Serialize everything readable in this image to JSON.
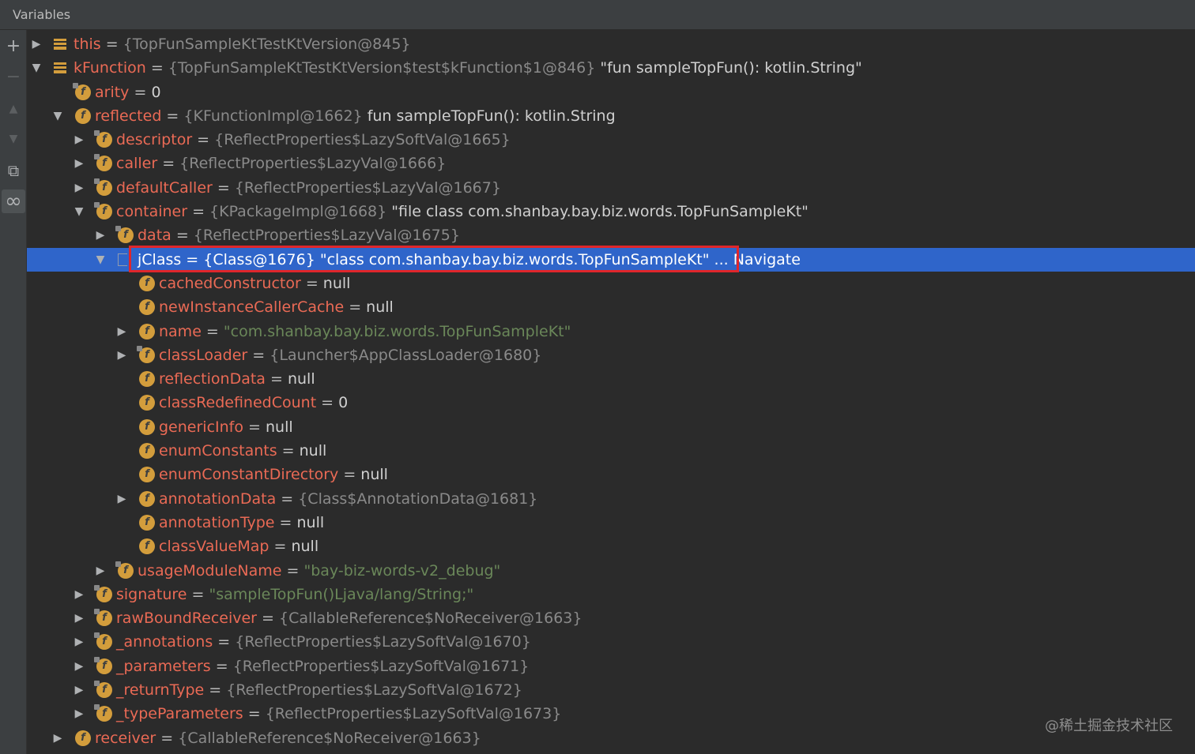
{
  "panel": {
    "title": "Variables"
  },
  "sidebar": {
    "buttons": [
      {
        "name": "add-watch",
        "glyph": "+"
      },
      {
        "name": "remove-watch",
        "glyph": "−"
      },
      {
        "name": "move-up",
        "glyph": "▲"
      },
      {
        "name": "move-down",
        "glyph": "▼"
      },
      {
        "name": "copy",
        "glyph": "⧉"
      },
      {
        "name": "show-watches",
        "glyph": "∞"
      }
    ]
  },
  "rows": [
    {
      "name": "this",
      "eq": " = ",
      "value": "{TopFunSampleKtTestKtVersion@845}",
      "vtype": "ref",
      "arrow": "▶",
      "icon": "stack",
      "depth": 0
    },
    {
      "name": "kFunction",
      "eq": " = ",
      "value": "{TopFunSampleKtTestKtVersion$test$kFunction$1@846}",
      "extra": " \"fun sampleTopFun(): kotlin.String\"",
      "vtype": "ref",
      "arrow": "▼",
      "icon": "stack",
      "depth": 0
    },
    {
      "name": "arity",
      "eq": " = ",
      "value": "0",
      "vtype": "val",
      "arrow": "",
      "icon": "f-lock",
      "depth": 1
    },
    {
      "name": "reflected",
      "eq": " = ",
      "value": "{KFunctionImpl@1662}",
      "extra": " fun sampleTopFun(): kotlin.String",
      "vtype": "ref",
      "arrow": "▼",
      "icon": "f",
      "depth": 1
    },
    {
      "name": "descriptor",
      "eq": " = ",
      "value": "{ReflectProperties$LazySoftVal@1665}",
      "vtype": "ref",
      "arrow": "▶",
      "icon": "f-lock",
      "depth": 2
    },
    {
      "name": "caller",
      "eq": " = ",
      "value": "{ReflectProperties$LazyVal@1666}",
      "vtype": "ref",
      "arrow": "▶",
      "icon": "f-lock",
      "depth": 2
    },
    {
      "name": "defaultCaller",
      "eq": " = ",
      "value": "{ReflectProperties$LazyVal@1667}",
      "vtype": "ref",
      "arrow": "▶",
      "icon": "f-lock",
      "depth": 2
    },
    {
      "name": "container",
      "eq": " = ",
      "value": "{KPackageImpl@1668}",
      "extra": " \"file class com.shanbay.bay.biz.words.TopFunSampleKt\"",
      "vtype": "ref",
      "arrow": "▼",
      "icon": "f-lock",
      "depth": 2
    },
    {
      "name": "data",
      "eq": " = ",
      "value": "{ReflectProperties$LazyVal@1675}",
      "vtype": "ref",
      "arrow": "▶",
      "icon": "f-lock",
      "depth": 3
    },
    {
      "name": "jClass",
      "eq": " = ",
      "value": "{Class@1676}",
      "extra": " \"class com.shanbay.bay.biz.words.TopFunSampleKt\"",
      "navigate": " ... Navigate",
      "vtype": "val",
      "arrow": "▼",
      "icon": "flag",
      "depth": 3,
      "selected": true
    },
    {
      "name": "cachedConstructor",
      "eq": " = ",
      "value": "null",
      "vtype": "val",
      "arrow": "",
      "icon": "f",
      "depth": 4
    },
    {
      "name": "newInstanceCallerCache",
      "eq": " = ",
      "value": "null",
      "vtype": "val",
      "arrow": "",
      "icon": "f",
      "depth": 4
    },
    {
      "name": "name",
      "eq": " = ",
      "value": "\"com.shanbay.bay.biz.words.TopFunSampleKt\"",
      "vtype": "str",
      "arrow": "▶",
      "icon": "f",
      "depth": 4
    },
    {
      "name": "classLoader",
      "eq": " = ",
      "value": "{Launcher$AppClassLoader@1680}",
      "vtype": "ref",
      "arrow": "▶",
      "icon": "f-lock",
      "depth": 4
    },
    {
      "name": "reflectionData",
      "eq": " = ",
      "value": "null",
      "vtype": "val",
      "arrow": "",
      "icon": "f",
      "depth": 4
    },
    {
      "name": "classRedefinedCount",
      "eq": " = ",
      "value": "0",
      "vtype": "val",
      "arrow": "",
      "icon": "f",
      "depth": 4
    },
    {
      "name": "genericInfo",
      "eq": " = ",
      "value": "null",
      "vtype": "val",
      "arrow": "",
      "icon": "f",
      "depth": 4
    },
    {
      "name": "enumConstants",
      "eq": " = ",
      "value": "null",
      "vtype": "val",
      "arrow": "",
      "icon": "f",
      "depth": 4
    },
    {
      "name": "enumConstantDirectory",
      "eq": " = ",
      "value": "null",
      "vtype": "val",
      "arrow": "",
      "icon": "f",
      "depth": 4
    },
    {
      "name": "annotationData",
      "eq": " = ",
      "value": "{Class$AnnotationData@1681}",
      "vtype": "ref",
      "arrow": "▶",
      "icon": "f",
      "depth": 4
    },
    {
      "name": "annotationType",
      "eq": " = ",
      "value": "null",
      "vtype": "val",
      "arrow": "",
      "icon": "f",
      "depth": 4
    },
    {
      "name": "classValueMap",
      "eq": " = ",
      "value": "null",
      "vtype": "val",
      "arrow": "",
      "icon": "f",
      "depth": 4
    },
    {
      "name": "usageModuleName",
      "eq": " = ",
      "value": "\"bay-biz-words-v2_debug\"",
      "vtype": "str",
      "arrow": "▶",
      "icon": "f-lock",
      "depth": 3
    },
    {
      "name": "signature",
      "eq": " = ",
      "value": "\"sampleTopFun()Ljava/lang/String;\"",
      "vtype": "str",
      "arrow": "▶",
      "icon": "f-lock",
      "depth": 2
    },
    {
      "name": "rawBoundReceiver",
      "eq": " = ",
      "value": "{CallableReference$NoReceiver@1663}",
      "vtype": "ref",
      "arrow": "▶",
      "icon": "f-lock",
      "depth": 2
    },
    {
      "name": "_annotations",
      "eq": " = ",
      "value": "{ReflectProperties$LazySoftVal@1670}",
      "vtype": "ref",
      "arrow": "▶",
      "icon": "f-lock",
      "depth": 2
    },
    {
      "name": "_parameters",
      "eq": " = ",
      "value": "{ReflectProperties$LazySoftVal@1671}",
      "vtype": "ref",
      "arrow": "▶",
      "icon": "f-lock",
      "depth": 2
    },
    {
      "name": "_returnType",
      "eq": " = ",
      "value": "{ReflectProperties$LazySoftVal@1672}",
      "vtype": "ref",
      "arrow": "▶",
      "icon": "f-lock",
      "depth": 2
    },
    {
      "name": "_typeParameters",
      "eq": " = ",
      "value": "{ReflectProperties$LazySoftVal@1673}",
      "vtype": "ref",
      "arrow": "▶",
      "icon": "f-lock",
      "depth": 2
    },
    {
      "name": "receiver",
      "eq": " = ",
      "value": "{CallableReference$NoReceiver@1663}",
      "vtype": "ref",
      "arrow": "▶",
      "icon": "f",
      "depth": 1
    }
  ],
  "watermark": "@稀土掘金技术社区"
}
